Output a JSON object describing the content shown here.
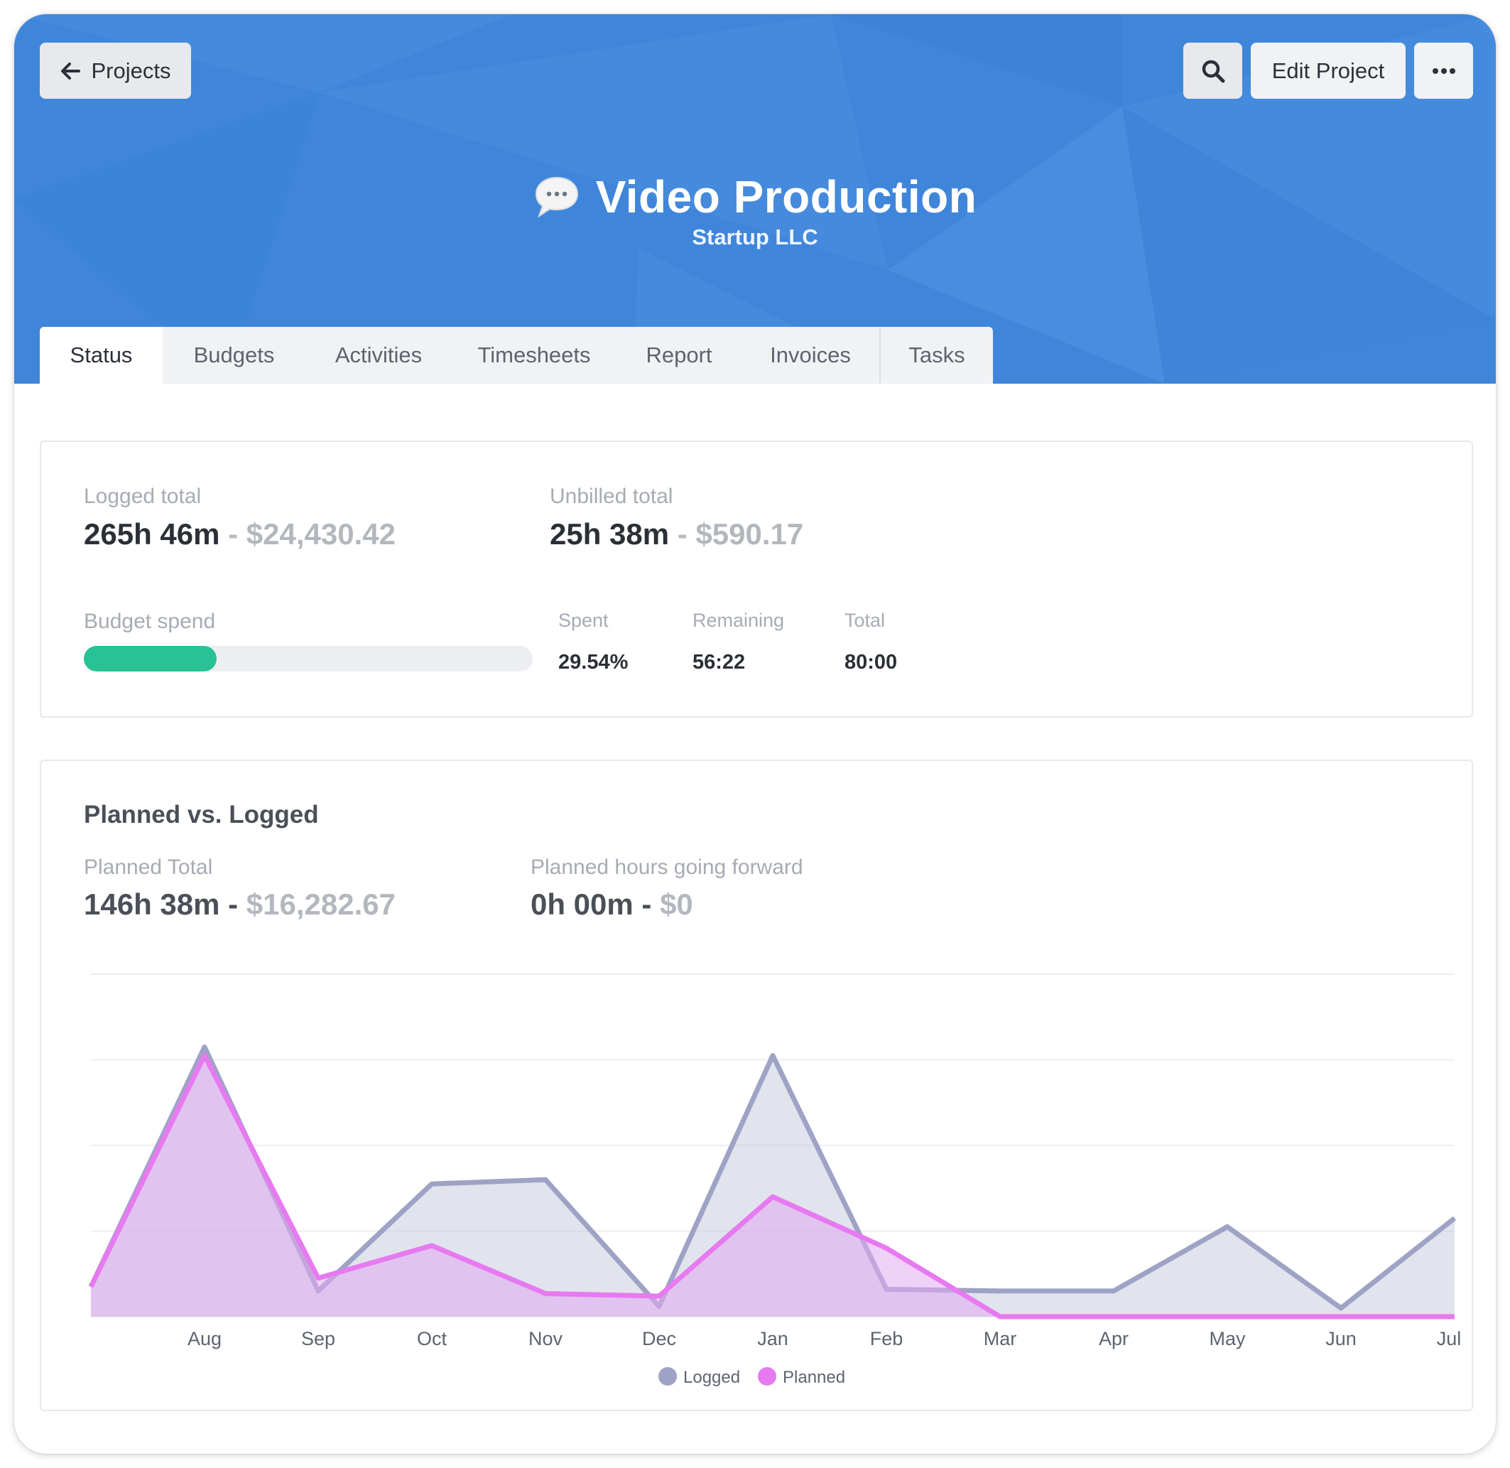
{
  "nav": {
    "back_label": "Projects",
    "edit_label": "Edit Project"
  },
  "project": {
    "title": "Video Production",
    "client": "Startup LLC"
  },
  "tabs": [
    {
      "label": "Status",
      "active": true
    },
    {
      "label": "Budgets",
      "active": false
    },
    {
      "label": "Activities",
      "active": false
    },
    {
      "label": "Timesheets",
      "active": false
    },
    {
      "label": "Report",
      "active": false
    },
    {
      "label": "Invoices",
      "active": false
    },
    {
      "label": "Tasks",
      "active": false
    }
  ],
  "summary": {
    "logged_label": "Logged total",
    "logged_hours": "265h 46m",
    "logged_amount": "$24,430.42",
    "unbilled_label": "Unbilled total",
    "unbilled_hours": "25h 38m",
    "unbilled_amount": "$590.17",
    "budget_label": "Budget spend",
    "budget_percent": 29.54,
    "spent_label": "Spent",
    "spent_value": "29.54%",
    "remaining_label": "Remaining",
    "remaining_value": "56:22",
    "total_label": "Total",
    "total_value": "80:00"
  },
  "planned": {
    "section_title": "Planned vs. Logged",
    "planned_total_label": "Planned Total",
    "planned_total_hours": "146h 38m",
    "planned_total_amount": "$16,282.67",
    "forward_label": "Planned hours going forward",
    "forward_hours": "0h 00m",
    "forward_amount": "$0"
  },
  "colors": {
    "header_blue": "#3f86db",
    "progress_green": "#27c395",
    "logged": "#9ea3c6",
    "planned": "#e77af0"
  },
  "icons": {
    "back": "arrow-left-icon",
    "search": "search-icon",
    "more": "more-dots-icon",
    "project": "speech-bubble-icon"
  },
  "chart_data": {
    "type": "area",
    "categories": [
      "Jul",
      "Aug",
      "Sep",
      "Oct",
      "Nov",
      "Dec",
      "Jan",
      "Feb",
      "Mar",
      "Apr",
      "May",
      "Jun",
      "Jul"
    ],
    "tick_labels": [
      "",
      "Aug",
      "Sep",
      "Oct",
      "Nov",
      "Dec",
      "Jan",
      "Feb",
      "Mar",
      "Apr",
      "May",
      "Jun",
      "Jul"
    ],
    "ylim": [
      0,
      40
    ],
    "grid": true,
    "legend_position": "bottom",
    "series": [
      {
        "name": "Logged",
        "values": [
          3.5,
          31.5,
          3.0,
          15.5,
          16.0,
          1.2,
          30.5,
          3.2,
          3.0,
          3.0,
          10.5,
          1.0,
          11.5
        ]
      },
      {
        "name": "Planned",
        "values": [
          3.5,
          30.5,
          4.5,
          8.3,
          2.7,
          2.4,
          14.0,
          8.0,
          0,
          0,
          0,
          0,
          0
        ]
      }
    ]
  }
}
